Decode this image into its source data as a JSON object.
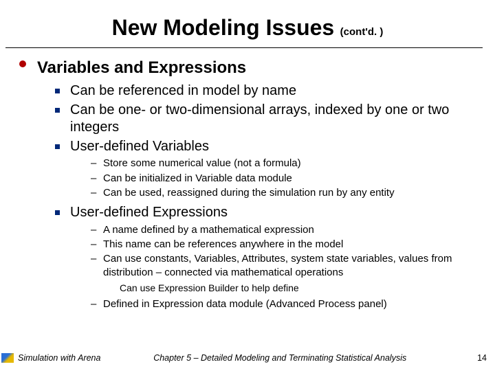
{
  "title": "New  Modeling Issues",
  "title_suffix": "(cont'd. )",
  "heading": "Variables and Expressions",
  "b1": "Can be referenced in model by name",
  "b2": "Can be one- or two-dimensional arrays, indexed by one or two integers",
  "b3": "User-defined Variables",
  "b3_1": "Store some numerical value (not a formula)",
  "b3_2": "Can be initialized in Variable data module",
  "b3_3": "Can be used, reassigned during the simulation run by any entity",
  "b4": "User-defined Expressions",
  "b4_1": "A name defined by a mathematical expression",
  "b4_2": "This name can be references anywhere in the model",
  "b4_3": "Can use constants, Variables, Attributes, system state variables, values from distribution – connected via mathematical operations",
  "b4_3a": "Can use Expression Builder to help define",
  "b4_4": "Defined in Expression data module (Advanced Process panel)",
  "footer_left": "Simulation with Arena",
  "footer_center": "Chapter 5 – Detailed Modeling and Terminating Statistical Analysis",
  "footer_right": "14"
}
